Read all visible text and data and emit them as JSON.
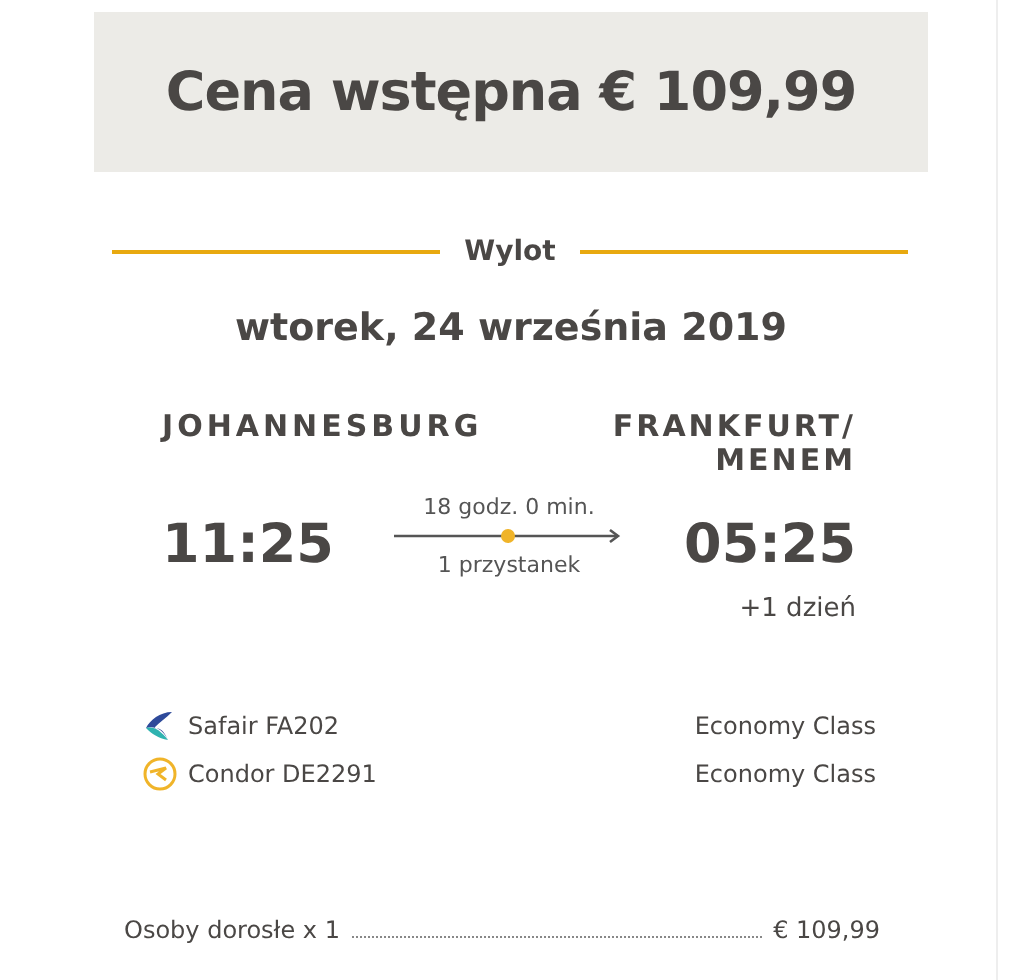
{
  "price_header": "Cena wstępna € 109,99",
  "section_title": "Wylot",
  "date": "wtorek, 24 września 2019",
  "origin": {
    "city": "JOHANNESBURG",
    "time": "11:25"
  },
  "destination": {
    "city_lines": [
      "FRANKFURT/",
      "MENEM"
    ],
    "time": "05:25",
    "day_offset": "+1 dzień"
  },
  "journey": {
    "duration": "18 godz. 0 min.",
    "stops": "1 przystanek"
  },
  "segments": [
    {
      "airline": "Safair FA202",
      "kind": "swoosh",
      "cabin": "Economy Class"
    },
    {
      "airline": "Condor DE2291",
      "kind": "ring",
      "cabin": "Economy Class"
    }
  ],
  "fare": {
    "label": "Osoby dorosłe x 1",
    "amount": "€ 109,99"
  }
}
